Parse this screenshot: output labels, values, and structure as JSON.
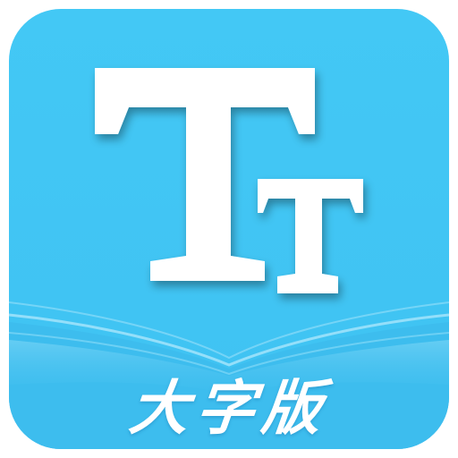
{
  "icon": {
    "label": "大字版",
    "glyph_name": "large-text-icon"
  },
  "colors": {
    "primary": "#42C6F4",
    "primary_dark": "#3BB8EA",
    "wave_light": "#7FD8F8",
    "glyph": "#FFFFFF",
    "shadow": "#1E8FCB"
  }
}
